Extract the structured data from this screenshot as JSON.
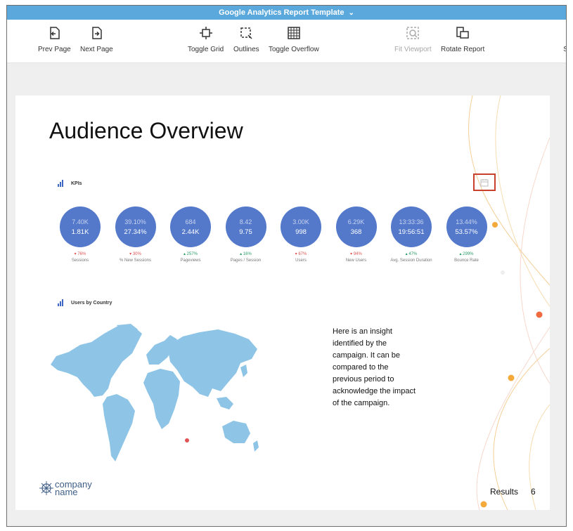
{
  "window": {
    "title": "Google Analytics Report Template"
  },
  "toolbar": {
    "prev_page": "Prev Page",
    "next_page": "Next Page",
    "toggle_grid": "Toggle Grid",
    "outlines": "Outlines",
    "toggle_overflow": "Toggle Overflow",
    "fit_viewport": "Fit Viewport",
    "rotate_report": "Rotate Report",
    "cut_off_label": "St"
  },
  "slide": {
    "title": "Audience Overview",
    "kpi_section_label": "KPIs",
    "kpis": [
      {
        "label": "Sessions",
        "previous": "7.40K",
        "current": "1.81K",
        "change": "▾ 76%",
        "direction": "down"
      },
      {
        "label": "% New Sessions",
        "previous": "39.10%",
        "current": "27.34%",
        "change": "▾ 30%",
        "direction": "down"
      },
      {
        "label": "Pageviews",
        "previous": "684",
        "current": "2.44K",
        "change": "▴ 257%",
        "direction": "up"
      },
      {
        "label": "Pages / Session",
        "previous": "8.42",
        "current": "9.75",
        "change": "▴ 16%",
        "direction": "up"
      },
      {
        "label": "Users",
        "previous": "3.00K",
        "current": "998",
        "change": "▾ 67%",
        "direction": "down"
      },
      {
        "label": "New Users",
        "previous": "6.29K",
        "current": "368",
        "change": "▾ 94%",
        "direction": "down"
      },
      {
        "label": "Avg. Session Duration",
        "previous": "13:33:36",
        "current": "19:56:51",
        "change": "▴ 47%",
        "direction": "up"
      },
      {
        "label": "Bounce Rate",
        "previous": "13.44%",
        "current": "53.57%",
        "change": "▴ 299%",
        "direction": "up"
      }
    ],
    "map_section_label": "Users by Country",
    "insight_text": "Here is an insight identified by the campaign. It can be compared to the previous period to acknowledge the impact of the campaign.",
    "logo_line1": "company",
    "logo_line2": "name",
    "footer_label": "Results",
    "footer_page": "6"
  },
  "colors": {
    "titlebar": "#5aa8dc",
    "kpi_circle": "#5479cb",
    "map_land": "#8ec4e6",
    "decrease": "#e05454",
    "increase": "#2a9d6a",
    "calendar_highlight": "#c9402c"
  },
  "icons": {
    "prev_page": "prev-page-icon",
    "next_page": "next-page-icon",
    "toggle_grid": "grid-icon",
    "outlines": "outlines-icon",
    "toggle_overflow": "overflow-icon",
    "fit_viewport": "fit-viewport-icon",
    "rotate_report": "rotate-icon",
    "calendar": "calendar-icon",
    "chevron": "chevron-down-icon"
  }
}
